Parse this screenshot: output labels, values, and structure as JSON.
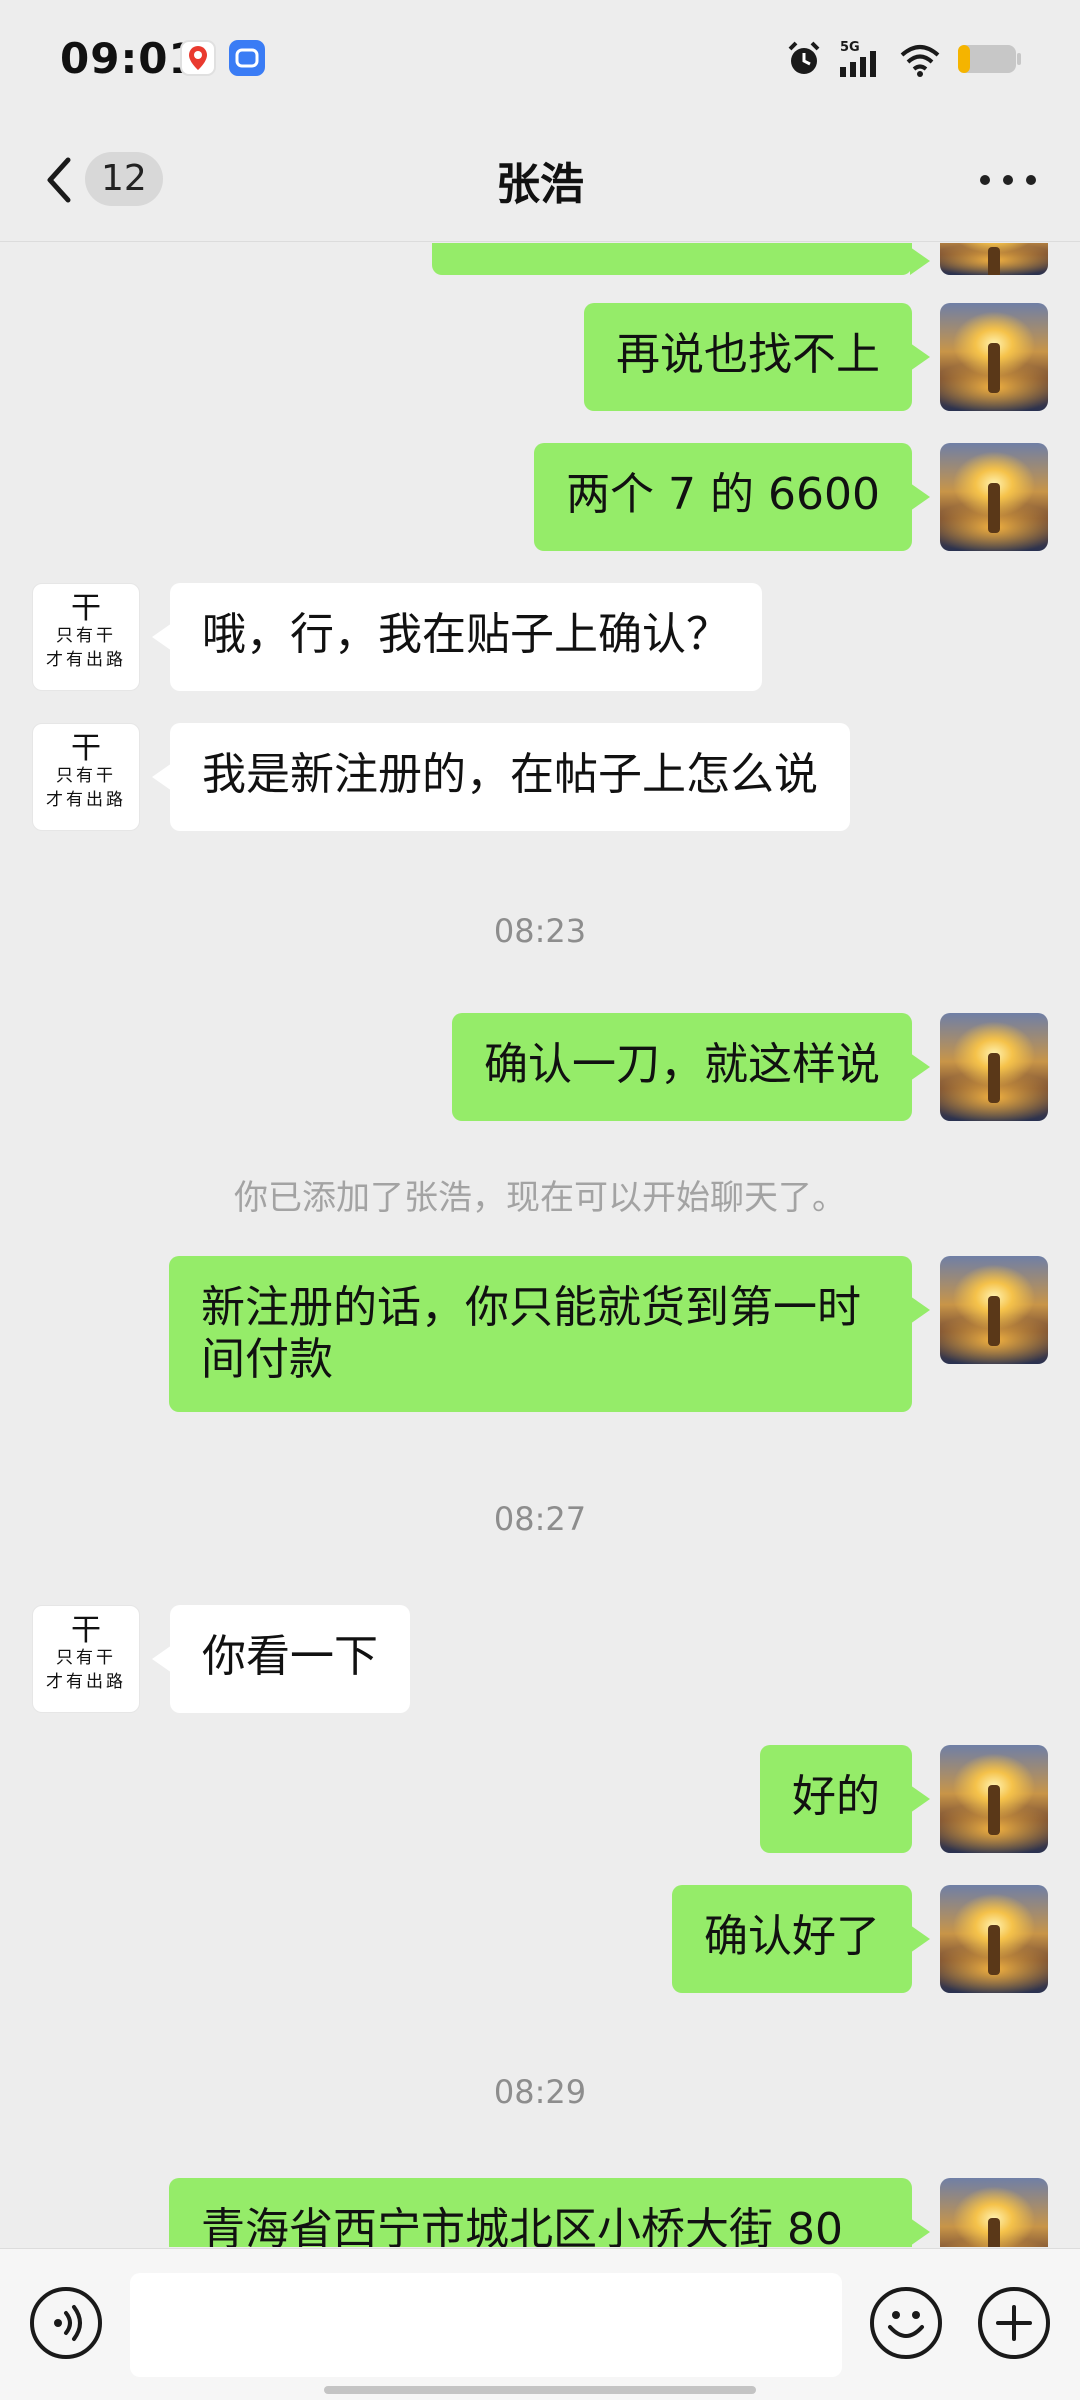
{
  "status_bar": {
    "time": "09:01",
    "network": "5G",
    "icons": [
      "baidu-maps-app-icon",
      "messaging-app-icon",
      "alarm-icon",
      "signal-5g-icon",
      "wifi-icon",
      "battery-low-icon"
    ],
    "battery_level": 0.2,
    "battery_color": "#f5b400"
  },
  "nav": {
    "title": "张浩",
    "unread_count": "12"
  },
  "other_avatar": {
    "line1": "干",
    "line2": "只有干",
    "line3": "才有出路"
  },
  "messages": [
    {
      "type": "self",
      "text": ""
    },
    {
      "type": "self",
      "text": "再说也找不上"
    },
    {
      "type": "self",
      "text": "两个 7 的 6600"
    },
    {
      "type": "other",
      "text": "哦，行，我在贴子上确认？"
    },
    {
      "type": "other",
      "text": "我是新注册的，在帖子上怎么说"
    },
    {
      "type": "time",
      "text": "08:23"
    },
    {
      "type": "self",
      "text": "确认一刀，就这样说"
    },
    {
      "type": "system",
      "text": "你已添加了张浩，现在可以开始聊天了。"
    },
    {
      "type": "self",
      "text": "新注册的话，你只能就货到第一时间付款"
    },
    {
      "type": "time",
      "text": "08:27"
    },
    {
      "type": "other",
      "text": "你看一下"
    },
    {
      "type": "self",
      "text": "好的"
    },
    {
      "type": "self",
      "text": "确认好了"
    },
    {
      "type": "time",
      "text": "08:29"
    },
    {
      "type": "self",
      "text": "青海省西宁市城北区小桥大街 80"
    }
  ],
  "input_bar": {
    "placeholder": "",
    "value": ""
  },
  "colors": {
    "background": "#ededed",
    "self_bubble": "#95ec69",
    "other_bubble": "#ffffff",
    "timestamp": "#8d8d8d"
  }
}
